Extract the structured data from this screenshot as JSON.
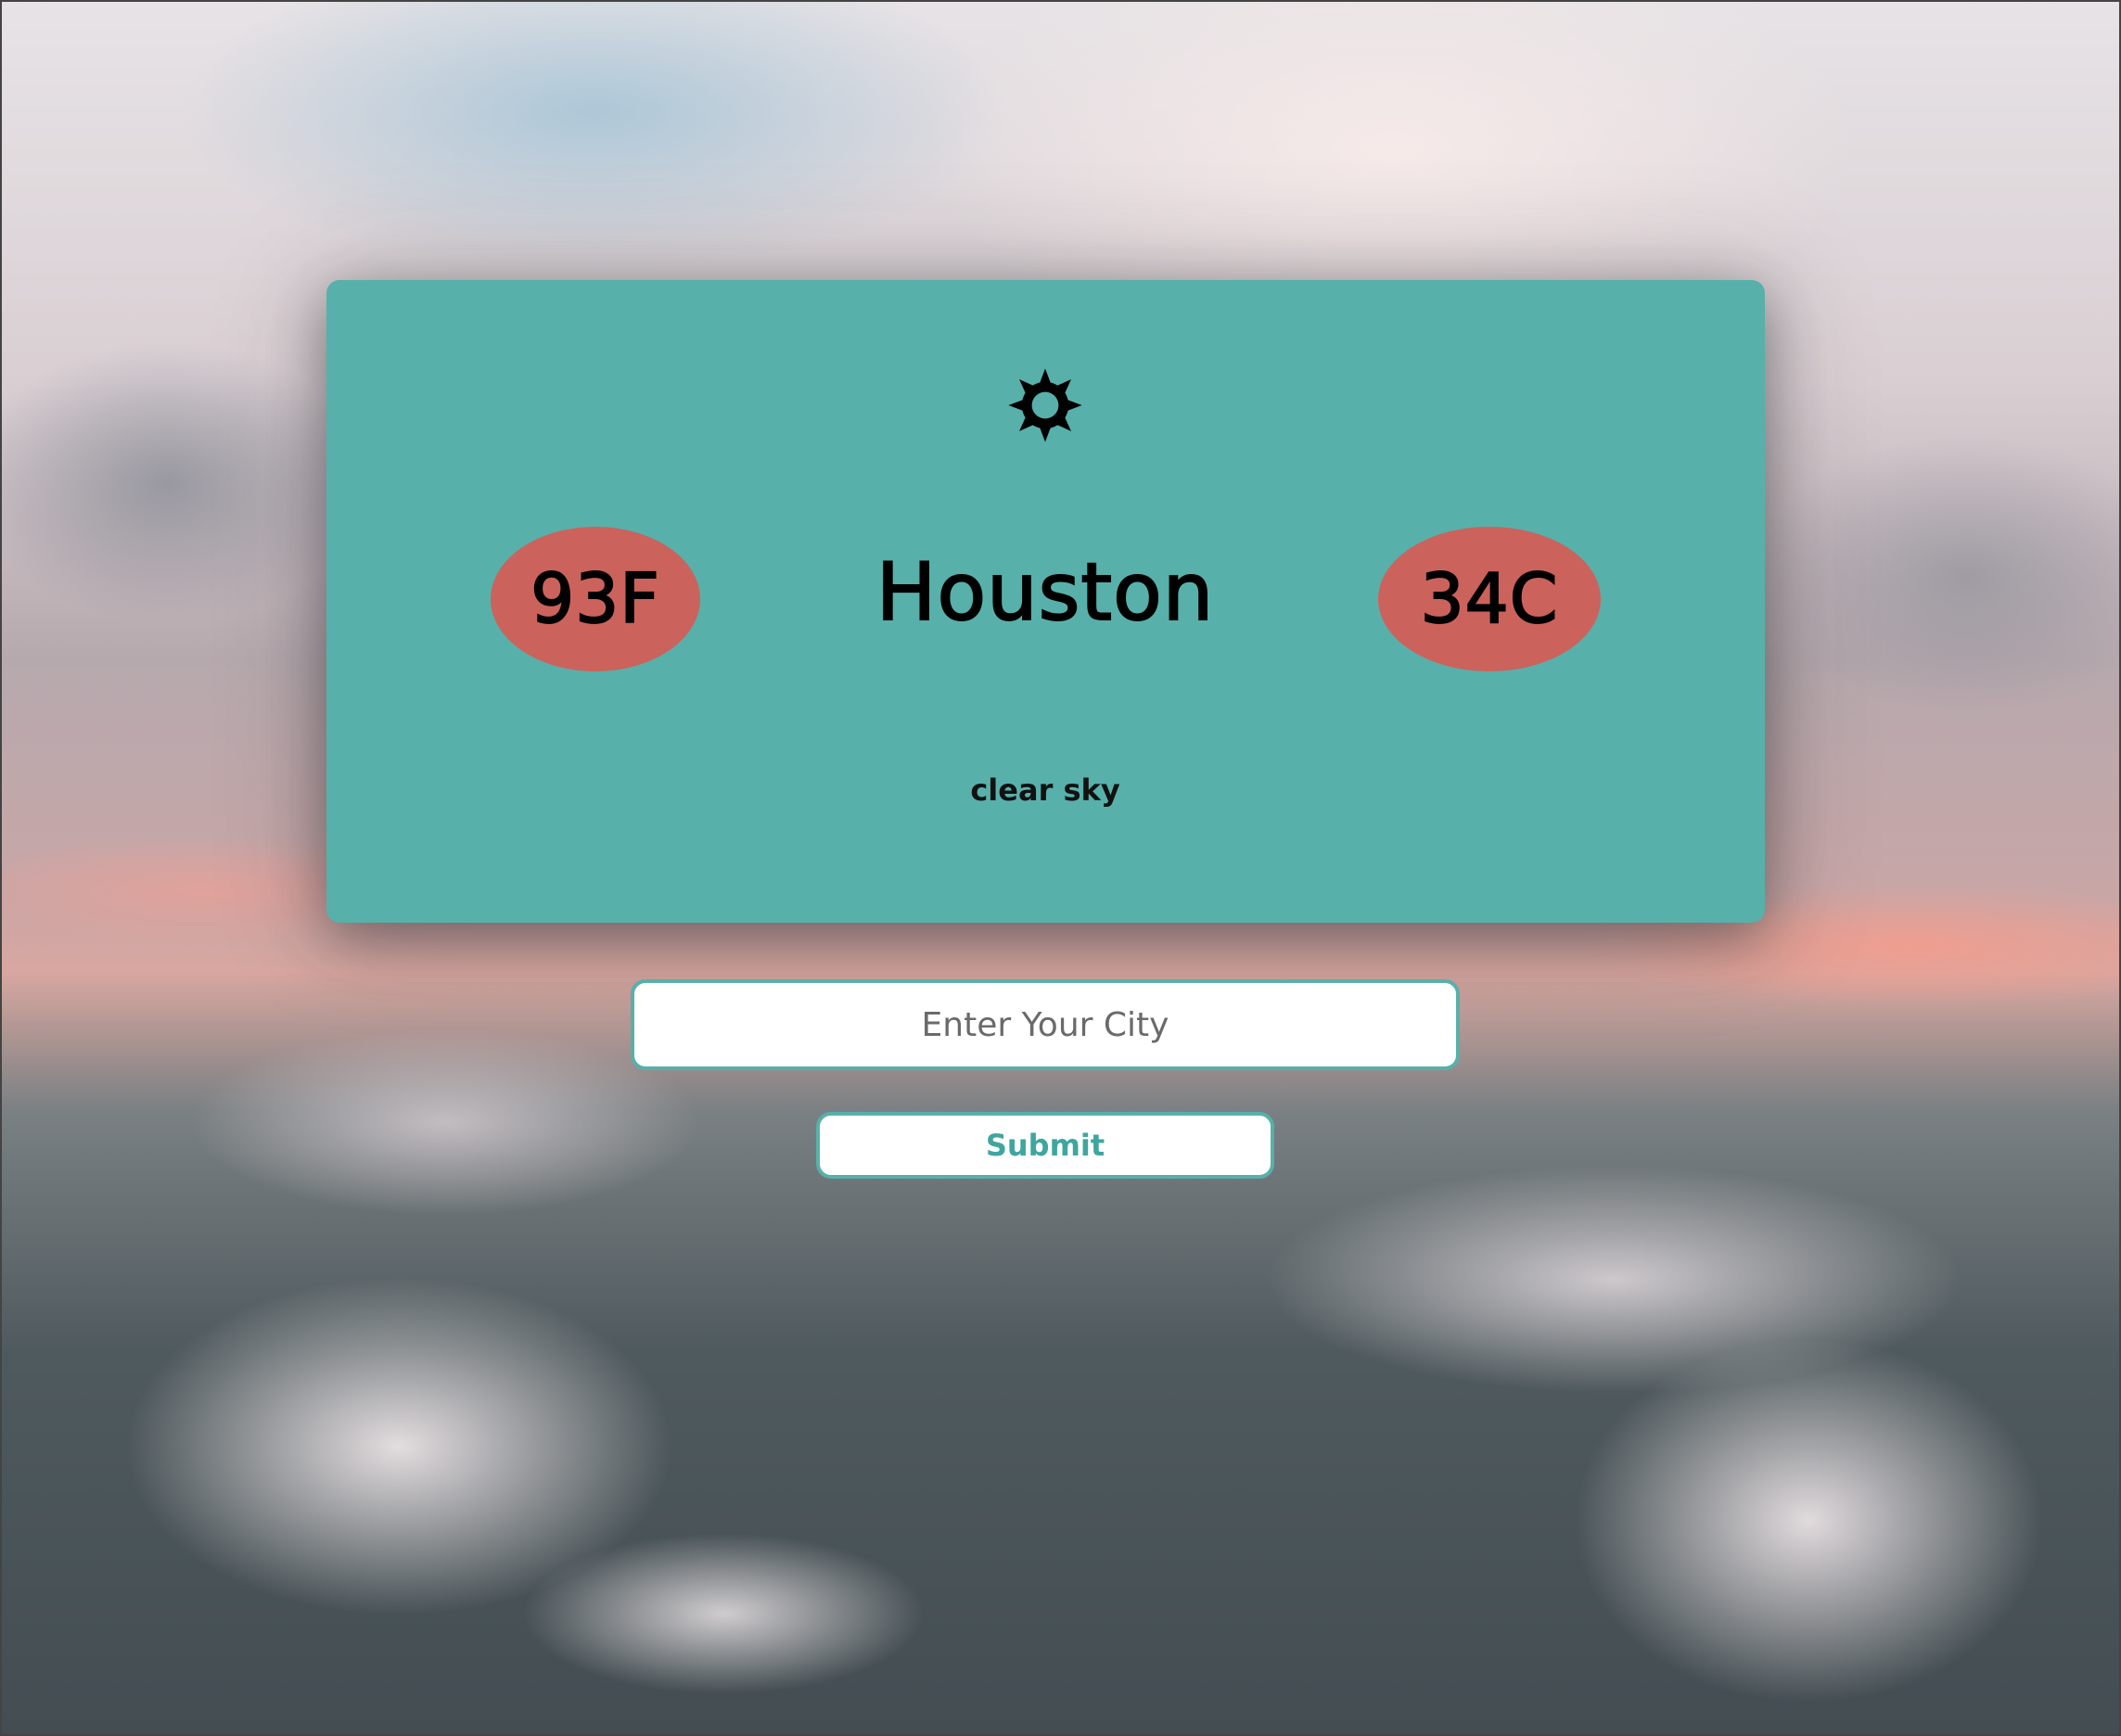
{
  "weather": {
    "icon": "sun-icon",
    "temp_f": "93F",
    "city": "Houston",
    "temp_c": "34C",
    "description": "clear sky"
  },
  "search": {
    "placeholder": "Enter Your City",
    "value": ""
  },
  "actions": {
    "submit_label": "Submit"
  },
  "colors": {
    "card": "#58b0aa",
    "temp_badge": "#cc625c",
    "accent": "#58b0aa",
    "button_text": "#3fa69f"
  }
}
